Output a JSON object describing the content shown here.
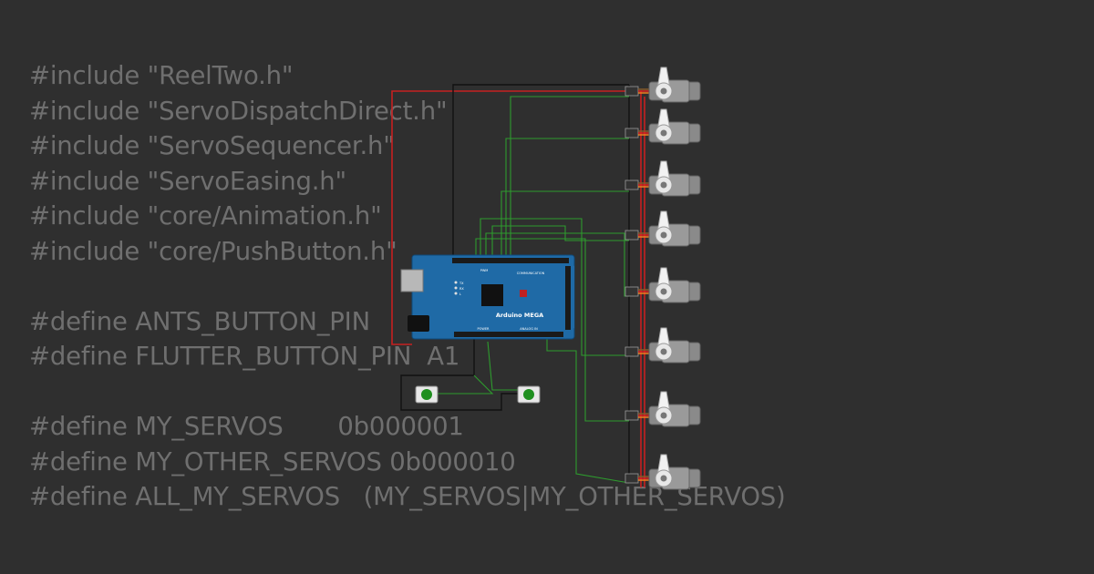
{
  "code_lines": [
    "#include \"ReelTwo.h\"",
    "#include \"ServoDispatchDirect.h\"",
    "#include \"ServoSequencer.h\"",
    "#include \"ServoEasing.h\"",
    "#include \"core/Animation.h\"",
    "#include \"core/PushButton.h\"",
    "",
    "#define ANTS_BUTTON_PIN",
    "#define FLUTTER_BUTTON_PIN  A1",
    "",
    "#define MY_SERVOS       0b000001",
    "#define MY_OTHER_SERVOS 0b000010",
    "#define ALL_MY_SERVOS   (MY_SERVOS|MY_OTHER_SERVOS)"
  ],
  "board": {
    "name": "Arduino MEGA",
    "label_communication": "COMMUNICATION",
    "label_pwm": "PWM",
    "label_power": "POWER",
    "label_analog": "ANALOG IN",
    "label_tx": "TX",
    "label_rx": "RX",
    "label_l": "L"
  },
  "colors": {
    "background": "#2f2f2f",
    "code_text": "#6f6f6f",
    "board_blue": "#1f6aa6",
    "wire_red": "#c62020",
    "wire_green": "#2e9b2e",
    "wire_black": "#111111",
    "button_green": "#1f8f1f",
    "servo_gray": "#8a8a8a"
  },
  "icons": {
    "servo": "servo-motor-icon",
    "pushbutton": "pushbutton-icon",
    "chip": "microcontroller-chip-icon"
  }
}
